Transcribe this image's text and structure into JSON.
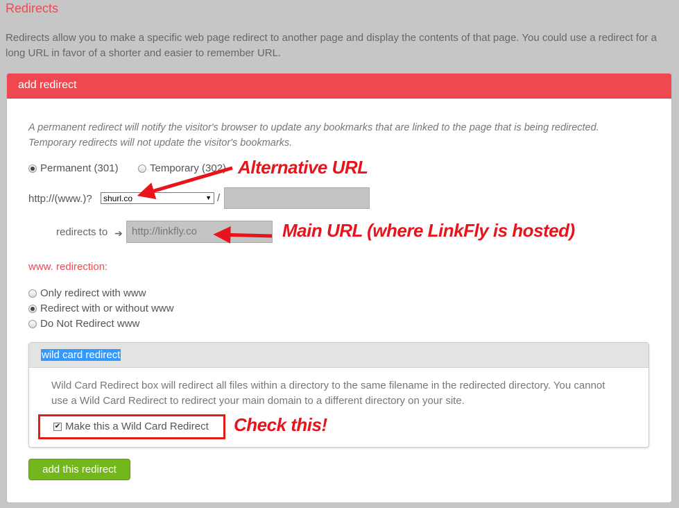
{
  "page": {
    "title": "Redirects",
    "intro": "Redirects allow you to make a specific web page redirect to another page and display the contents of that page. You could use a redirect for a long URL in favor of a shorter and easier to remember URL."
  },
  "panel": {
    "header": "add redirect",
    "note": "A permanent redirect will notify the visitor's browser to update any bookmarks that are linked to the page that is being redirected. Temporary redirects will not update the visitor's bookmarks.",
    "type_options": [
      {
        "label": "Permanent (301)",
        "selected": true
      },
      {
        "label": "Temporary (302)",
        "selected": false
      }
    ],
    "url_prefix": "http://(www.)?",
    "domain_value": "shurl.co",
    "slash": "/",
    "path_value": "",
    "redirects_to_label": "redirects to",
    "target_value": "http://linkfly.co",
    "www_heading": "www. redirection:",
    "www_options": [
      {
        "label": "Only redirect with www",
        "selected": false
      },
      {
        "label": "Redirect with or without www",
        "selected": true
      },
      {
        "label": "Do Not Redirect www",
        "selected": false
      }
    ],
    "wildcard": {
      "header": "wild card redirect",
      "text": "Wild Card Redirect box will redirect all files within a directory to the same filename in the redirected directory. You cannot use a Wild Card Redirect to redirect your main domain to a different directory on your site.",
      "checkbox_label": "Make this a Wild Card Redirect",
      "checked": true
    },
    "submit_label": "add this redirect"
  },
  "annotations": {
    "alt_url": "Alternative URL",
    "main_url": "Main URL (where LinkFly is hosted)",
    "check": "Check this!"
  },
  "colors": {
    "accent": "#ef4850",
    "button": "#74b71c",
    "annotation": "#e8141c"
  }
}
